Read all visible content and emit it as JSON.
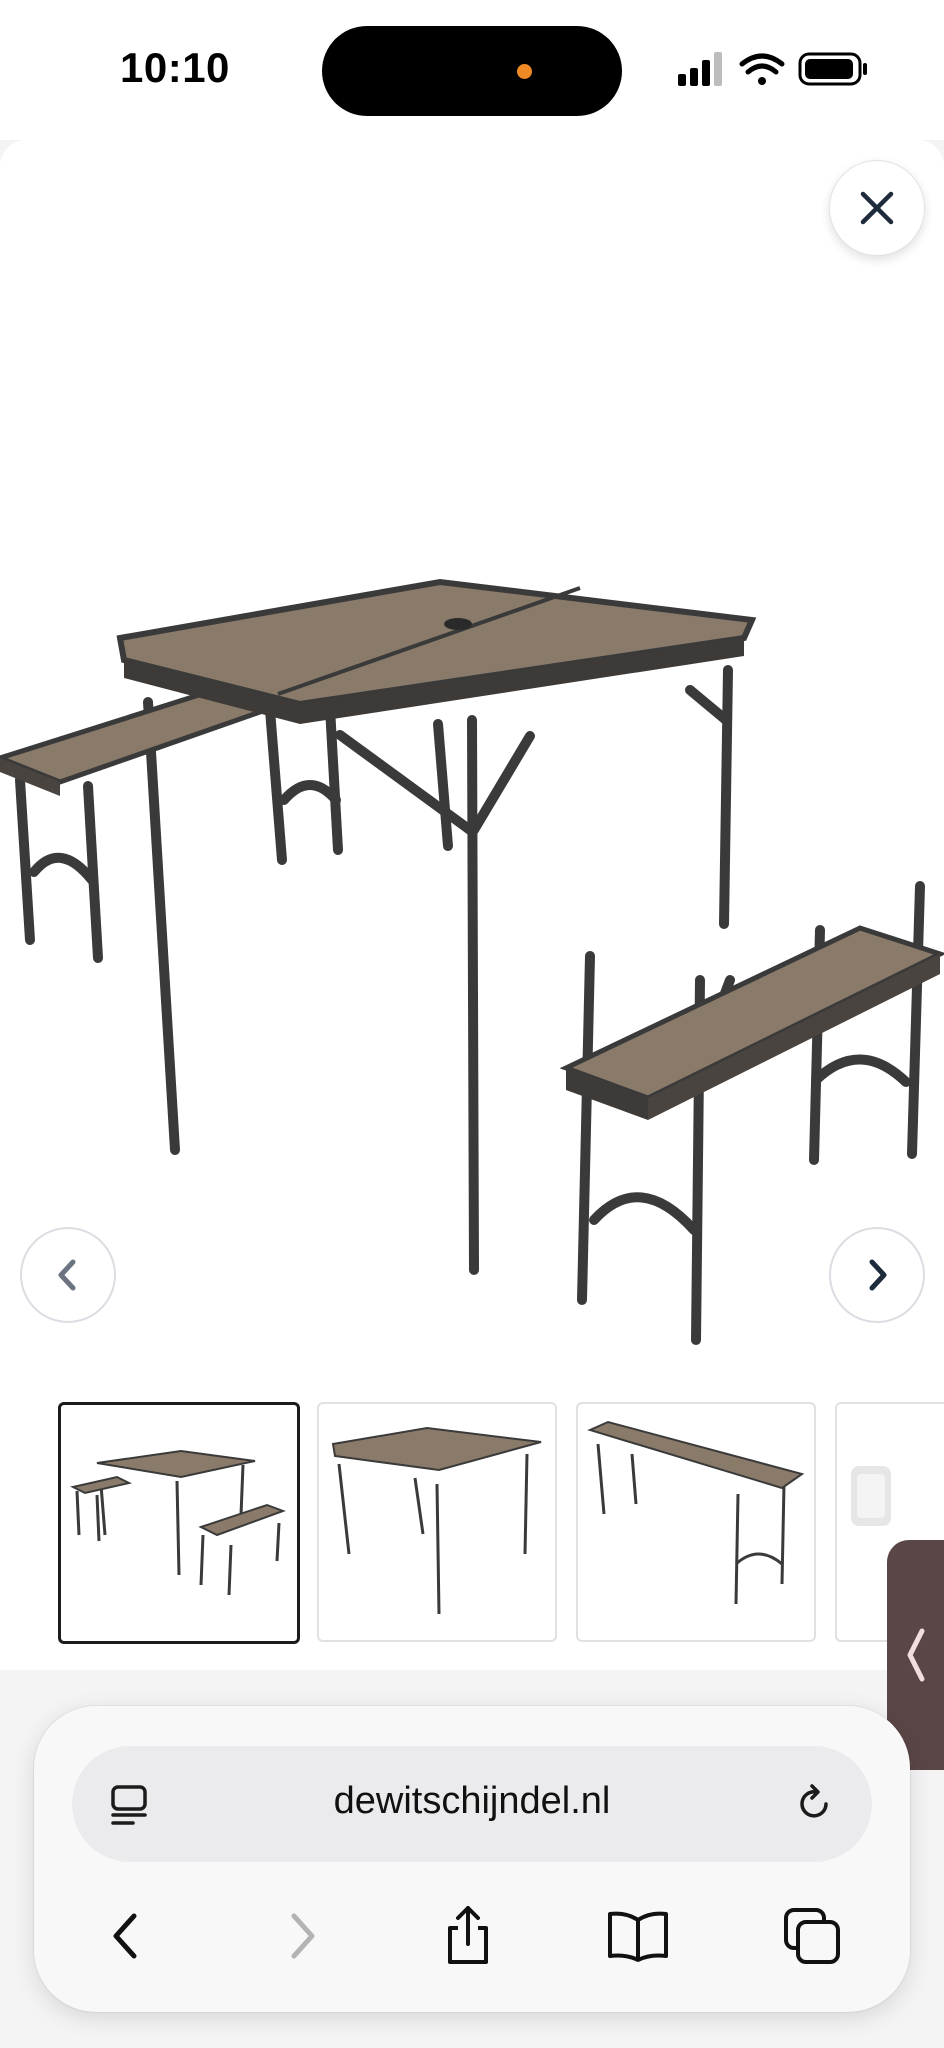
{
  "status": {
    "time": "10:10",
    "signal_icon": "cellular-signal-icon",
    "wifi_icon": "wifi-icon",
    "battery_icon": "battery-icon"
  },
  "gallery": {
    "close_icon": "close-icon",
    "prev_icon": "chevron-left-icon",
    "next_icon": "chevron-right-icon",
    "main_image_subject": "folding picnic table with two benches",
    "thumbnails": [
      {
        "subject": "table with two benches",
        "selected": true
      },
      {
        "subject": "folding table",
        "selected": false
      },
      {
        "subject": "folding bench",
        "selected": false
      },
      {
        "subject": "folded table",
        "selected": false
      }
    ]
  },
  "browser": {
    "url": "dewitschijndel.nl",
    "reader_icon": "page-menu-icon",
    "reload_icon": "reload-icon",
    "back_icon": "back-icon",
    "forward_icon": "forward-icon",
    "share_icon": "share-icon",
    "bookmarks_icon": "bookmarks-icon",
    "tabs_icon": "tabs-icon"
  },
  "colors": {
    "side_tab": "#5a4646",
    "island_indicator": "#f08a24",
    "wood": "#8a7a6a",
    "frame": "#3a3a3a"
  }
}
